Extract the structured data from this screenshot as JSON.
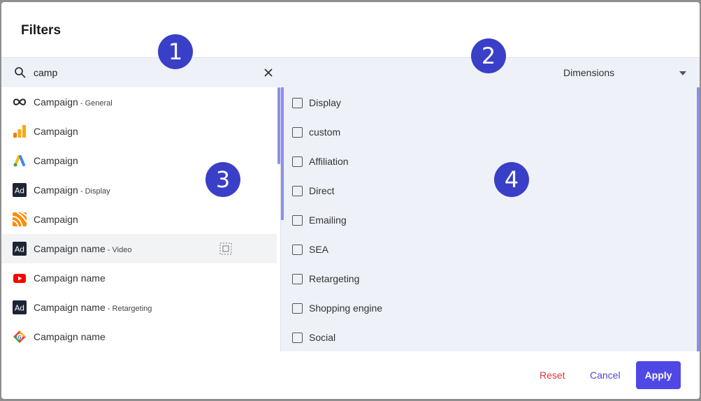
{
  "dialog": {
    "title": "Filters"
  },
  "search": {
    "value": "camp",
    "clear_icon": "close-icon"
  },
  "dimension_select": {
    "selected": "Dimensions"
  },
  "left_list": [
    {
      "label": "Campaign",
      "sub": " - General",
      "icon": "infinity-icon"
    },
    {
      "label": "Campaign",
      "sub": "",
      "icon": "google-analytics-icon"
    },
    {
      "label": "Campaign",
      "sub": "",
      "icon": "google-ads-icon"
    },
    {
      "label": "Campaign",
      "sub": " - Display",
      "icon": "adobe-ad-icon"
    },
    {
      "label": "Campaign",
      "sub": "",
      "icon": "orange-stripes-icon"
    },
    {
      "label": "Campaign name",
      "sub": " - Video",
      "icon": "adobe-ad-icon"
    },
    {
      "label": "Campaign name",
      "sub": "",
      "icon": "youtube-icon"
    },
    {
      "label": "Campaign name",
      "sub": " - Retargeting",
      "icon": "adobe-ad-icon"
    },
    {
      "label": "Campaign name",
      "sub": "",
      "icon": "google-tag-icon"
    }
  ],
  "right_list": [
    "Display",
    "custom",
    "Affiliation",
    "Direct",
    "Emailing",
    "SEA",
    "Retargeting",
    "Shopping engine",
    "Social"
  ],
  "footer": {
    "reset": "Reset",
    "cancel": "Cancel",
    "apply": "Apply"
  },
  "markers": [
    "1",
    "2",
    "3",
    "4"
  ],
  "colors": {
    "accent": "#5048e5",
    "reset": "#d9363e",
    "panel": "#eef2f8",
    "marker": "#3a3fc8"
  }
}
